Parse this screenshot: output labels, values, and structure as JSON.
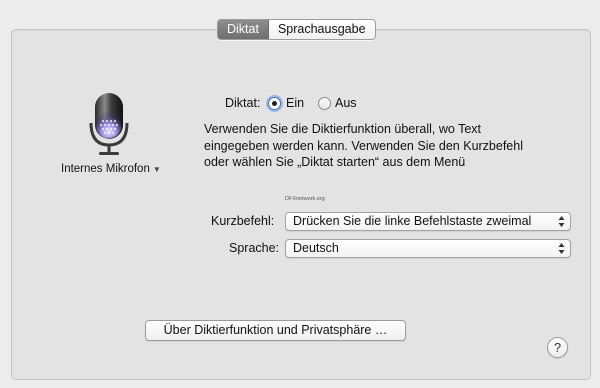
{
  "tabs": [
    {
      "label": "Diktat",
      "selected": true
    },
    {
      "label": "Sprachausgabe",
      "selected": false
    }
  ],
  "mic": {
    "label": "Internes Mikrofon"
  },
  "dictation": {
    "label": "Diktat:",
    "options": [
      {
        "label": "Ein",
        "selected": true
      },
      {
        "label": "Aus",
        "selected": false
      }
    ],
    "description_lines": [
      "Verwenden Sie die Diktierfunktion überall, wo Text",
      "eingegeben werden kann. Verwenden Sie den Kurzbefehl",
      "oder wählen Sie „Diktat starten“ aus dem Menü"
    ]
  },
  "watermark": "DFXnetwork.org",
  "shortcut": {
    "label": "Kurzbefehl:",
    "value": "Drücken Sie die linke Befehlstaste zweimal"
  },
  "language": {
    "label": "Sprache:",
    "value": "Deutsch"
  },
  "privacy_button": "Über Diktierfunktion und Privatsphäre …",
  "help": "?"
}
